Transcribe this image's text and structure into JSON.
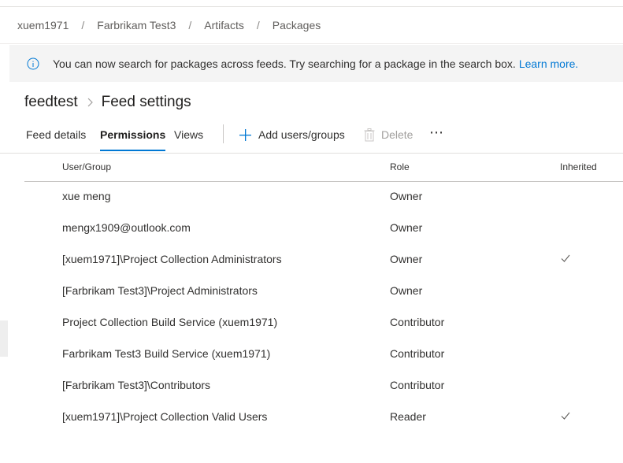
{
  "breadcrumb": [
    "xuem1971",
    "Farbrikam Test3",
    "Artifacts",
    "Packages"
  ],
  "banner": {
    "message": "You can now search for packages across feeds. Try searching for a package in the search box.",
    "link": "Learn more."
  },
  "header": {
    "feed_name": "feedtest",
    "page_title": "Feed settings"
  },
  "tabs": [
    {
      "label": "Feed details",
      "active": false
    },
    {
      "label": "Permissions",
      "active": true
    },
    {
      "label": "Views",
      "active": false
    }
  ],
  "commands": {
    "add_label": "Add users/groups",
    "delete_label": "Delete",
    "more_label": "⋯"
  },
  "table": {
    "columns": [
      "User/Group",
      "Role",
      "Inherited"
    ],
    "rows": [
      {
        "user": "xue meng",
        "role": "Owner",
        "inherited": false
      },
      {
        "user": "mengx1909@outlook.com",
        "role": "Owner",
        "inherited": false
      },
      {
        "user": "[xuem1971]\\Project Collection Administrators",
        "role": "Owner",
        "inherited": true
      },
      {
        "user": "[Farbrikam Test3]\\Project Administrators",
        "role": "Owner",
        "inherited": false
      },
      {
        "user": "Project Collection Build Service (xuem1971)",
        "role": "Contributor",
        "inherited": false
      },
      {
        "user": "Farbrikam Test3 Build Service (xuem1971)",
        "role": "Contributor",
        "inherited": false
      },
      {
        "user": "[Farbrikam Test3]\\Contributors",
        "role": "Contributor",
        "inherited": false
      },
      {
        "user": "[xuem1971]\\Project Collection Valid Users",
        "role": "Reader",
        "inherited": true
      }
    ]
  },
  "colors": {
    "accent": "#0078d4",
    "banner_bg": "#f4f4f4",
    "text": "#323130",
    "disabled": "#a19f9d"
  },
  "icons": {
    "info": "info-icon",
    "add": "plus-icon",
    "delete": "trash-icon",
    "inherited": "checkmark-icon"
  }
}
